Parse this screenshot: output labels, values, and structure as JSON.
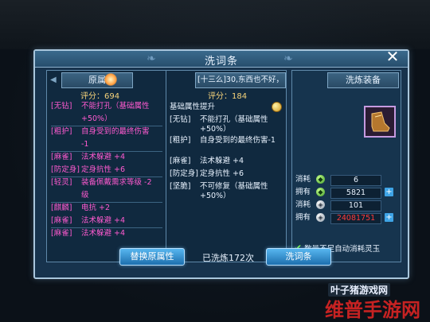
{
  "dialog": {
    "title": "洗词条",
    "close_glyph": "✕"
  },
  "left_panel": {
    "header": "原属",
    "score": "评分：694",
    "rows": [
      {
        "tag": "[无钻]",
        "val": "不能打孔（基础属性",
        "color": "pink"
      },
      {
        "tag": "",
        "val": "+50%）",
        "color": "pink"
      },
      {
        "tag": "[粗护]",
        "val": "自身受到的最终伤害",
        "color": "pink"
      },
      {
        "tag": "",
        "val": "-1",
        "color": "pink"
      },
      {
        "tag": "[麻雀]",
        "val": "法术躲避 +4",
        "color": "pink"
      },
      {
        "tag": "[防定身]",
        "val": "定身抗性 +6",
        "color": "pink"
      },
      {
        "tag": "[轻灵]",
        "val": "装备佩戴需求等级 -2",
        "color": "pink"
      },
      {
        "tag": "",
        "val": "级",
        "color": "pink"
      },
      {
        "tag": "[麒麟]",
        "val": "电抗 +2",
        "color": "pink"
      },
      {
        "tag": "[麻雀]",
        "val": "法术躲避 +4",
        "color": "pink"
      },
      {
        "tag": "[麻雀]",
        "val": "法术躲避 +4",
        "color": "pink"
      }
    ]
  },
  "mid_panel": {
    "header": "[十三么]30,东西也不好，",
    "score": "评分：184",
    "section_title": "基础属性提升",
    "rows": [
      {
        "tag": "[无钻]",
        "val": "不能打孔（基础属性+50%）"
      },
      {
        "tag": "[粗护]",
        "val": "自身受到的最终伤害-1"
      },
      {
        "tag": "[麻雀]",
        "val": "法术躲避 +4"
      },
      {
        "tag": "[防定身]",
        "val": "定身抗性 +6"
      },
      {
        "tag": "[坚脆]",
        "val": "不可修复（基础属性+50%）"
      }
    ]
  },
  "right_panel": {
    "header": "洗炼装备",
    "costs": [
      {
        "label": "消耗",
        "icon": "green-gem-icon",
        "value": "6",
        "color": "white",
        "plus": false
      },
      {
        "label": "拥有",
        "icon": "green-gem-icon",
        "value": "5821",
        "color": "white",
        "plus": true
      },
      {
        "label": "消耗",
        "icon": "silver-coin-icon",
        "value": "101",
        "color": "white",
        "plus": false
      },
      {
        "label": "拥有",
        "icon": "silver-coin-icon",
        "value": "24081751",
        "color": "red",
        "plus": true
      }
    ],
    "auto_consume_label": "数量不足自动消耗灵玉"
  },
  "footer": {
    "replace_button": "替换原属性",
    "wash_count": "已洗炼172次",
    "wash_button": "洗词条"
  },
  "watermark": {
    "small": "叶子猪游戏网",
    "big": "维普手游网"
  },
  "colors": {
    "dialog_bg": "#17334d",
    "border": "#a9c6dc",
    "button": "#1d6fae",
    "pink_text": "#ff5ad0",
    "green_text": "#6be56b",
    "red_text": "#ff3b3b"
  }
}
